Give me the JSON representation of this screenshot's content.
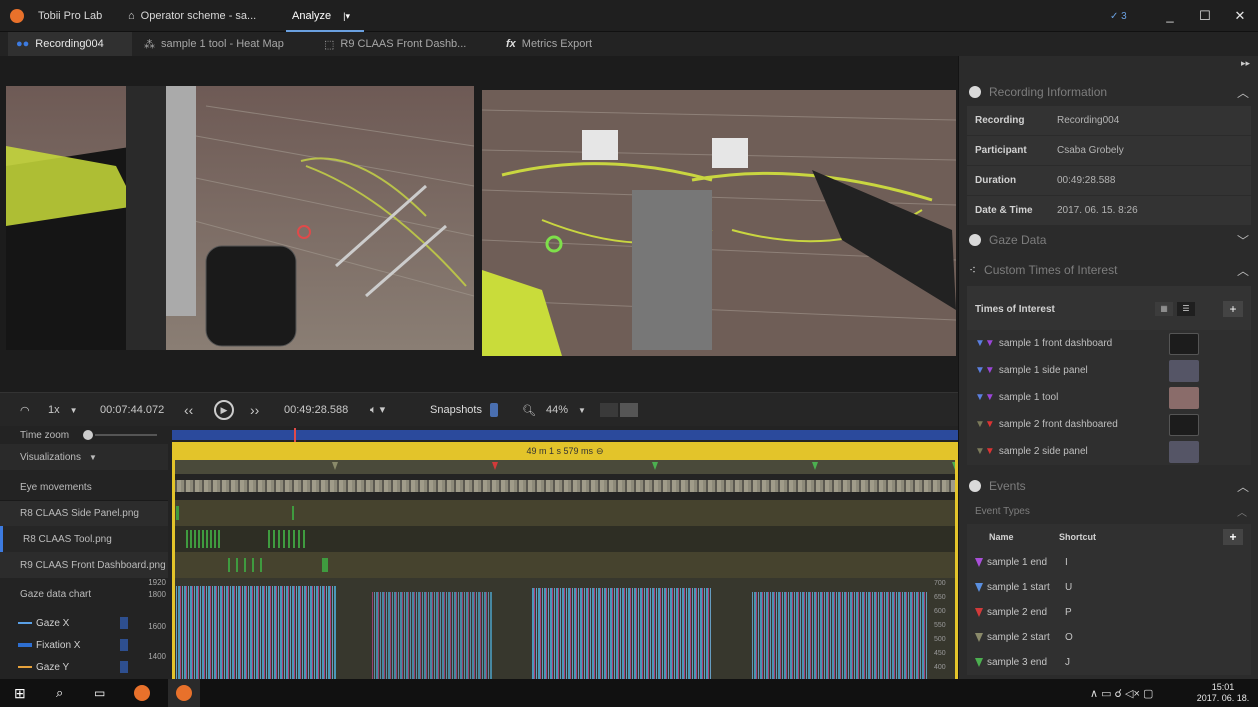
{
  "titlebar": {
    "app_name": "Tobii Pro Lab",
    "doc_tab": "Operator scheme - sa...",
    "analyze_tab": "Analyze",
    "win_controls": [
      "_",
      "☐",
      "✕"
    ]
  },
  "tabs": [
    {
      "label": "Recording004",
      "active": true
    },
    {
      "label": "sample 1 tool - Heat Map"
    },
    {
      "label": "R9 CLAAS  Front Dashb..."
    },
    {
      "label": "Metrics Export"
    }
  ],
  "playback": {
    "speed": "1x",
    "current_time": "00:07:44.072",
    "total_time": "00:49:28.588",
    "snapshots_label": "Snapshots",
    "zoom_level": "44%"
  },
  "timeline": {
    "time_zoom_label": "Time zoom",
    "visualizations_label": "Visualizations",
    "eye_movements_label": "Eye movements",
    "aoi_tracks": [
      "R8 CLAAS Side Panel.png",
      "R8 CLAAS Tool.png",
      "R9 CLAAS  Front Dashboard.png"
    ],
    "gaze_chart_label": "Gaze data chart",
    "selection_label": "49 m 1 s 579 ms",
    "legend": [
      {
        "label": "Gaze X",
        "color": "#5aa0e6"
      },
      {
        "label": "Fixation X",
        "color": "#2e6fd1"
      },
      {
        "label": "Gaze Y",
        "color": "#e6a23c"
      }
    ],
    "left_axis_ticks": [
      "1920",
      "1800",
      "1600",
      "1400"
    ],
    "right_axis_ticks": [
      "700",
      "650",
      "600",
      "550",
      "500",
      "450",
      "400"
    ]
  },
  "right_panel": {
    "recording_info": {
      "title": "Recording Information",
      "rows": [
        {
          "key": "Recording",
          "value": "Recording004"
        },
        {
          "key": "Participant",
          "value": "Csaba Grobely"
        },
        {
          "key": "Duration",
          "value": "00:49:28.588"
        },
        {
          "key": "Date & Time",
          "value": "2017. 06. 15. 8:26"
        }
      ]
    },
    "gaze_data_title": "Gaze Data",
    "custom_toi_title": "Custom Times of Interest",
    "toi_header": "Times of Interest",
    "toi_items": [
      {
        "label": "sample 1 front dashboard",
        "c1": "#5b7fe0",
        "c2": "#9b45d8"
      },
      {
        "label": "sample 1 side panel",
        "c1": "#5b7fe0",
        "c2": "#9b45d8"
      },
      {
        "label": "sample 1 tool",
        "c1": "#5b7fe0",
        "c2": "#9b45d8"
      },
      {
        "label": "sample 2 front dashboared",
        "c1": "#7a7a5a",
        "c2": "#d33"
      },
      {
        "label": "sample 2 side panel",
        "c1": "#7a7a5a",
        "c2": "#d33"
      }
    ],
    "events_title": "Events",
    "event_types_label": "Event Types",
    "events_columns": [
      "Name",
      "Shortcut"
    ],
    "events": [
      {
        "name": "sample 1 end",
        "shortcut": "I",
        "color": "#a94fd8"
      },
      {
        "name": "sample 1 start",
        "shortcut": "U",
        "color": "#5a8fe0"
      },
      {
        "name": "sample 2 end",
        "shortcut": "P",
        "color": "#d23a3a"
      },
      {
        "name": "sample 2 start",
        "shortcut": "O",
        "color": "#8a8a6a"
      },
      {
        "name": "sample 3 end",
        "shortcut": "J",
        "color": "#4caf50"
      }
    ]
  },
  "taskbar": {
    "time": "15:01",
    "date": "2017. 06. 18."
  }
}
